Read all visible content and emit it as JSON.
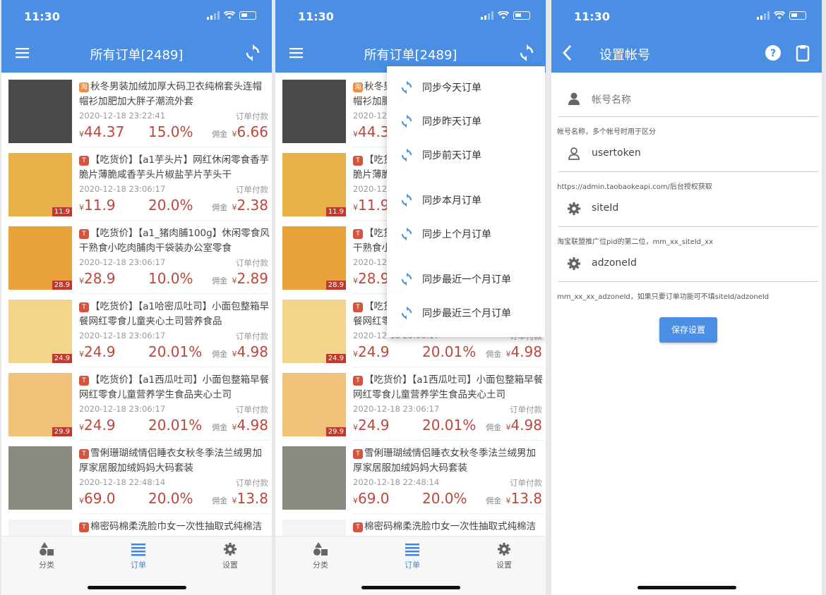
{
  "status": {
    "time": "11:30"
  },
  "orders": {
    "title": "所有订单[2489]",
    "items": [
      {
        "platform_tag": "淘",
        "title": "秋冬男装加绒加厚大码卫衣纯棉套头连帽帽衫加肥加大胖子潮流外套",
        "date": "2020-12-18 23:22:41",
        "status": "订单付款",
        "currency": "¥",
        "pay": "44.37",
        "rate": "15.0%",
        "comm_label": "佣金",
        "comm": "6.66",
        "thumb_color": "#4a4a4a",
        "thumb_price": ""
      },
      {
        "platform_tag": "T",
        "title": "【吃货价】【a1芋头片】网红休闲零食香芋脆片薄脆咸香芋头片椒盐芋片芋头干",
        "date": "2020-12-18 23:06:17",
        "status": "订单付款",
        "currency": "¥",
        "pay": "11.9",
        "rate": "20.0%",
        "comm_label": "佣金",
        "comm": "2.38",
        "thumb_color": "#e8b24a",
        "thumb_price": "11.9"
      },
      {
        "platform_tag": "T",
        "title": "【吃货价】【a1_猪肉脯100g】休闲零食风干熟食小吃肉脯肉干袋装办公室零食",
        "date": "2020-12-18 23:06:17",
        "status": "订单付款",
        "currency": "¥",
        "pay": "28.9",
        "rate": "10.0%",
        "comm_label": "佣金",
        "comm": "2.89",
        "thumb_color": "#e8a23a",
        "thumb_price": "28.9"
      },
      {
        "platform_tag": "T",
        "title": "【吃货价】【a1哈密瓜吐司】小面包整箱早餐网红零食儿童夹心土司营养食品",
        "date": "2020-12-18 23:06:17",
        "status": "订单付款",
        "currency": "¥",
        "pay": "24.9",
        "rate": "20.01%",
        "comm_label": "佣金",
        "comm": "4.98",
        "thumb_color": "#f2d48a",
        "thumb_price": "24.9"
      },
      {
        "platform_tag": "T",
        "title": "【吃货价】【a1西瓜吐司】小面包整箱早餐网红零食儿童营养学生食品夹心土司",
        "date": "2020-12-18 23:06:17",
        "status": "订单付款",
        "currency": "¥",
        "pay": "24.9",
        "rate": "20.01%",
        "comm_label": "佣金",
        "comm": "4.98",
        "thumb_color": "#f0c27a",
        "thumb_price": "29.9"
      },
      {
        "platform_tag": "T",
        "title": "雪俐珊瑚绒情侣睡衣女秋冬季法兰绒男加厚家居服加绒妈妈大码套装",
        "date": "2020-12-18 22:48:14",
        "status": "订单付款",
        "currency": "¥",
        "pay": "69.0",
        "rate": "20.0%",
        "comm_label": "佣金",
        "comm": "13.8",
        "thumb_color": "#8a8a80",
        "thumb_price": ""
      },
      {
        "platform_tag": "T",
        "title": "棉密码棉柔洗脸巾女一次性抽取式纯棉洁",
        "date": "",
        "status": "",
        "currency": "",
        "pay": "",
        "rate": "",
        "comm_label": "",
        "comm": "",
        "thumb_color": "#f4f4f4",
        "thumb_price": ""
      }
    ]
  },
  "tabs": [
    {
      "label": "分类"
    },
    {
      "label": "订单"
    },
    {
      "label": "设置"
    }
  ],
  "sync_menu": [
    {
      "label": "同步今天订单"
    },
    {
      "label": "同步昨天订单"
    },
    {
      "label": "同步前天订单"
    },
    {
      "label": "同步本月订单"
    },
    {
      "label": "同步上个月订单"
    },
    {
      "label": "同步最近一个月订单"
    },
    {
      "label": "同步最近三个月订单"
    }
  ],
  "settings": {
    "title": "设置帐号",
    "account_placeholder": "帐号名称",
    "account_hint": "帐号名称，多个帐号时用于区分",
    "usertoken": "usertoken",
    "usertoken_hint": "https://admin.taobaokeapi.com/后台授权获取",
    "siteid": "siteId",
    "siteid_hint": "淘宝联盟推广位pid的第二位，mm_xx_siteId_xx",
    "adzoneid": "adzoneId",
    "adzoneid_hint": "mm_xx_xx_adzoneId，如果只要订单功能可不填siteId/adzoneId",
    "save_label": "保存设置"
  },
  "colors": {
    "brand": "#4a8fe4",
    "price": "#c0463a",
    "active_tab": "#3d86e0"
  }
}
